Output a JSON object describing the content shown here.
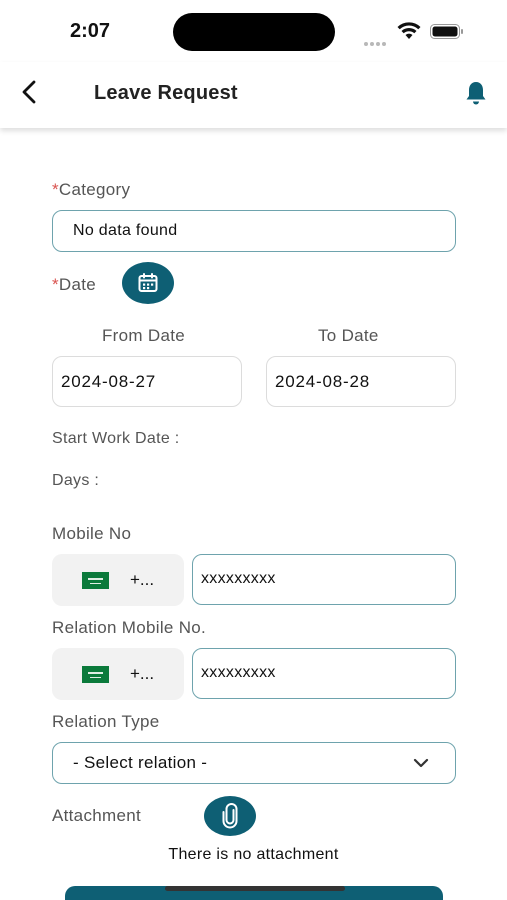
{
  "status": {
    "time": "2:07"
  },
  "header": {
    "title": "Leave Request"
  },
  "category": {
    "required_mark": "*",
    "label": "Category",
    "value": "No data found"
  },
  "date": {
    "required_mark": "*",
    "label": "Date",
    "from_label": "From Date",
    "to_label": "To Date",
    "from_value": "2024-08-27",
    "to_value": "2024-08-28"
  },
  "info": {
    "start_work_label": "Start Work Date :",
    "days_label": "Days :"
  },
  "mobile": {
    "label": "Mobile No",
    "code": "+...",
    "placeholder": "xxxxxxxxx"
  },
  "relation_mobile": {
    "label": "Relation Mobile No.",
    "code": "+...",
    "placeholder": "xxxxxxxxx"
  },
  "relation_type": {
    "label": "Relation Type",
    "selected": "- Select relation -"
  },
  "attachment": {
    "label": "Attachment",
    "empty_text": "There is no attachment"
  },
  "colors": {
    "primary": "#0e5f74",
    "border": "#6ea3ad",
    "required": "#d9534f"
  }
}
